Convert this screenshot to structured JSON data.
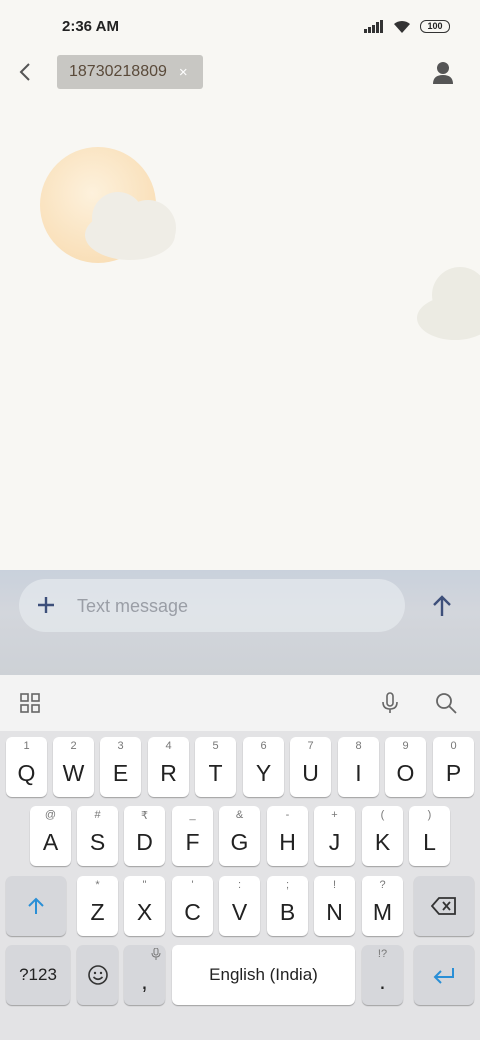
{
  "status": {
    "time": "2:36 AM",
    "battery": "100"
  },
  "header": {
    "recipient": "18730218809",
    "chip_remove": "×"
  },
  "compose": {
    "placeholder": "Text message"
  },
  "keyboard": {
    "row1": [
      {
        "label": "Q",
        "hint": "1"
      },
      {
        "label": "W",
        "hint": "2"
      },
      {
        "label": "E",
        "hint": "3"
      },
      {
        "label": "R",
        "hint": "4"
      },
      {
        "label": "T",
        "hint": "5"
      },
      {
        "label": "Y",
        "hint": "6"
      },
      {
        "label": "U",
        "hint": "7"
      },
      {
        "label": "I",
        "hint": "8"
      },
      {
        "label": "O",
        "hint": "9"
      },
      {
        "label": "P",
        "hint": "0"
      }
    ],
    "row2": [
      {
        "label": "A",
        "hint": "@"
      },
      {
        "label": "S",
        "hint": "#"
      },
      {
        "label": "D",
        "hint": "₹"
      },
      {
        "label": "F",
        "hint": "_"
      },
      {
        "label": "G",
        "hint": "&"
      },
      {
        "label": "H",
        "hint": "-"
      },
      {
        "label": "J",
        "hint": "+"
      },
      {
        "label": "K",
        "hint": "("
      },
      {
        "label": "L",
        "hint": ")"
      }
    ],
    "row3": [
      {
        "label": "Z",
        "hint": "*"
      },
      {
        "label": "X",
        "hint": "\""
      },
      {
        "label": "C",
        "hint": "'"
      },
      {
        "label": "V",
        "hint": ":"
      },
      {
        "label": "B",
        "hint": ";"
      },
      {
        "label": "N",
        "hint": "!"
      },
      {
        "label": "M",
        "hint": "?"
      }
    ],
    "symbols_label": "?123",
    "comma": ",",
    "space_label": "English (India)",
    "period": ".",
    "period_hint": "!?"
  },
  "colors": {
    "accent_blue": "#2a8fd6",
    "chip_bg": "#c8c7c3",
    "app_bg": "#f8f7f3"
  }
}
